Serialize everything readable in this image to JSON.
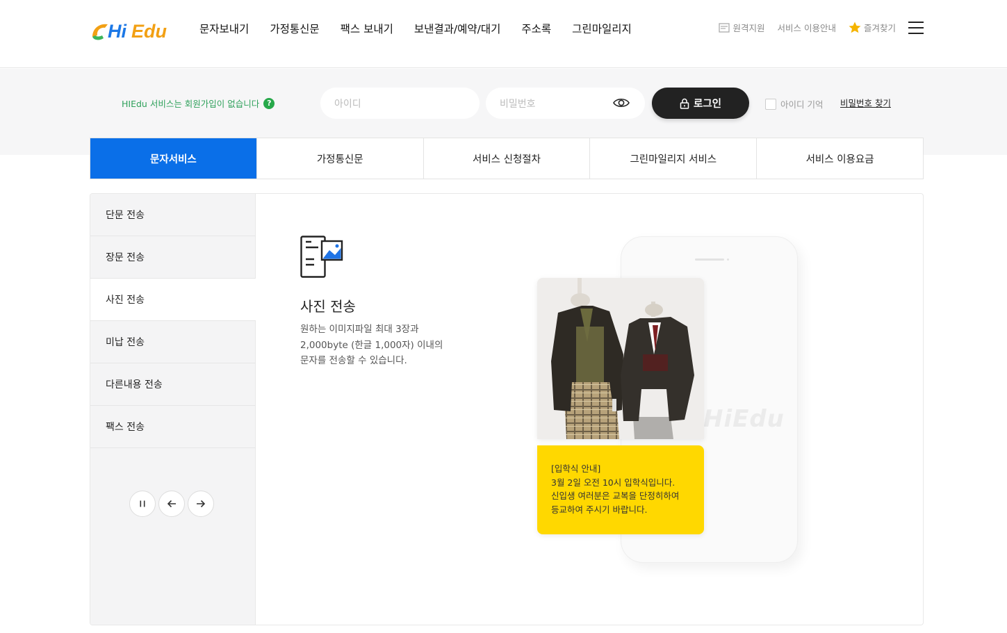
{
  "header": {
    "logo_text": "HiEdu",
    "nav": [
      "문자보내기",
      "가정통신문",
      "팩스 보내기",
      "보낸결과/예약/대기",
      "주소록",
      "그린마일리지"
    ],
    "util": {
      "remote_label": "원격지원",
      "guide_label": "서비스 이용안내",
      "favorite_label": "즐겨찾기"
    }
  },
  "login": {
    "notice": "HIEdu 서비스는 회원가입이 없습니다",
    "help_glyph": "?",
    "id_placeholder": "아이디",
    "pw_placeholder": "비밀번호",
    "login_label": "로그인",
    "remember_label": "아이디 기억",
    "find_pw_label": "비밀번호 찾기"
  },
  "tabs": [
    "문자서비스",
    "가정통신문",
    "서비스 신청절차",
    "그린마일리지 서비스",
    "서비스 이용요금"
  ],
  "active_tab": 0,
  "sidebar": [
    "단문 전송",
    "장문 전송",
    "사진 전송",
    "미납 전송",
    "다른내용 전송",
    "팩스 전송"
  ],
  "active_side": 2,
  "feature": {
    "icon": "photo-message-icon",
    "title": "사진 전송",
    "desc": [
      "원하는 이미지파일 최대 3장과",
      "2,000byte (한글 1,000자) 이내의",
      "문자를 전송할 수 있습니다."
    ]
  },
  "preview": {
    "watermark": "HiEdu",
    "message": [
      "[입학식 안내]",
      "3월 2일 오전 10시 입학식입니다.",
      "신입생 여러분은 교복을 단정히하여",
      "등교하여 주시기 바랍니다."
    ]
  },
  "colors": {
    "accent": "#0a6fe8",
    "dark_button": "#222222",
    "message_bg": "#ffd800",
    "notice_text": "#2ea05a"
  }
}
